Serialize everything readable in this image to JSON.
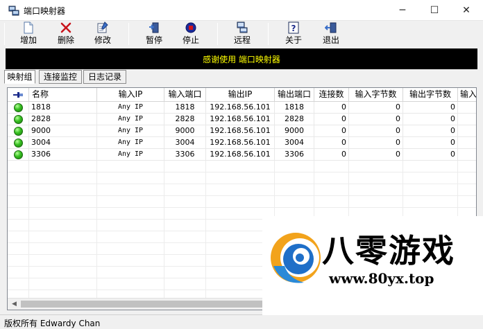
{
  "window": {
    "title": "端口映射器",
    "controls": {
      "minimize": "─",
      "maximize": "☐",
      "close": "✕"
    }
  },
  "toolbar": {
    "buttons": [
      {
        "label": "增加",
        "icon": "new-document-icon"
      },
      {
        "label": "删除",
        "icon": "delete-x-icon"
      },
      {
        "label": "修改",
        "icon": "edit-icon"
      },
      {
        "label": "暂停",
        "icon": "pause-door-icon"
      },
      {
        "label": "停止",
        "icon": "stop-icon"
      },
      {
        "label": "远程",
        "icon": "remote-computer-icon"
      },
      {
        "label": "关于",
        "icon": "help-icon"
      },
      {
        "label": "退出",
        "icon": "exit-door-icon"
      }
    ]
  },
  "banner": {
    "text": "感谢使用 端口映射器",
    "color": "#ffff00",
    "background": "#000000"
  },
  "tabs": [
    {
      "label": "映射组",
      "active": true
    },
    {
      "label": "连接监控",
      "active": false
    },
    {
      "label": "日志记录",
      "active": false
    }
  ],
  "table": {
    "pin_icon": "pin-icon",
    "columns": [
      "名称",
      "输入IP",
      "输入端口",
      "输出IP",
      "输出端口",
      "连接数",
      "输入字节数",
      "输出字节数",
      "输入"
    ],
    "rows": [
      {
        "status": "green",
        "name": "1818",
        "in_ip": "Any IP",
        "in_port": "1818",
        "out_ip": "192.168.56.101",
        "out_port": "1818",
        "conns": "0",
        "in_bytes": "0",
        "out_bytes": "0"
      },
      {
        "status": "green",
        "name": "2828",
        "in_ip": "Any IP",
        "in_port": "2828",
        "out_ip": "192.168.56.101",
        "out_port": "2828",
        "conns": "0",
        "in_bytes": "0",
        "out_bytes": "0"
      },
      {
        "status": "green",
        "name": "9000",
        "in_ip": "Any IP",
        "in_port": "9000",
        "out_ip": "192.168.56.101",
        "out_port": "9000",
        "conns": "0",
        "in_bytes": "0",
        "out_bytes": "0"
      },
      {
        "status": "green",
        "name": "3004",
        "in_ip": "Any IP",
        "in_port": "3004",
        "out_ip": "192.168.56.101",
        "out_port": "3004",
        "conns": "0",
        "in_bytes": "0",
        "out_bytes": "0"
      },
      {
        "status": "green",
        "name": "3306",
        "in_ip": "Any IP",
        "in_port": "3306",
        "out_ip": "192.168.56.101",
        "out_port": "3306",
        "conns": "0",
        "in_bytes": "0",
        "out_bytes": "0"
      }
    ],
    "scroll_left": "◀",
    "scroll_right": "▶"
  },
  "statusbar": {
    "text": "版权所有 Edwardy Chan"
  },
  "watermark": {
    "title": "八零游戏",
    "url": "www.80yx.top",
    "logo_icon": "80yx-logo-icon"
  }
}
